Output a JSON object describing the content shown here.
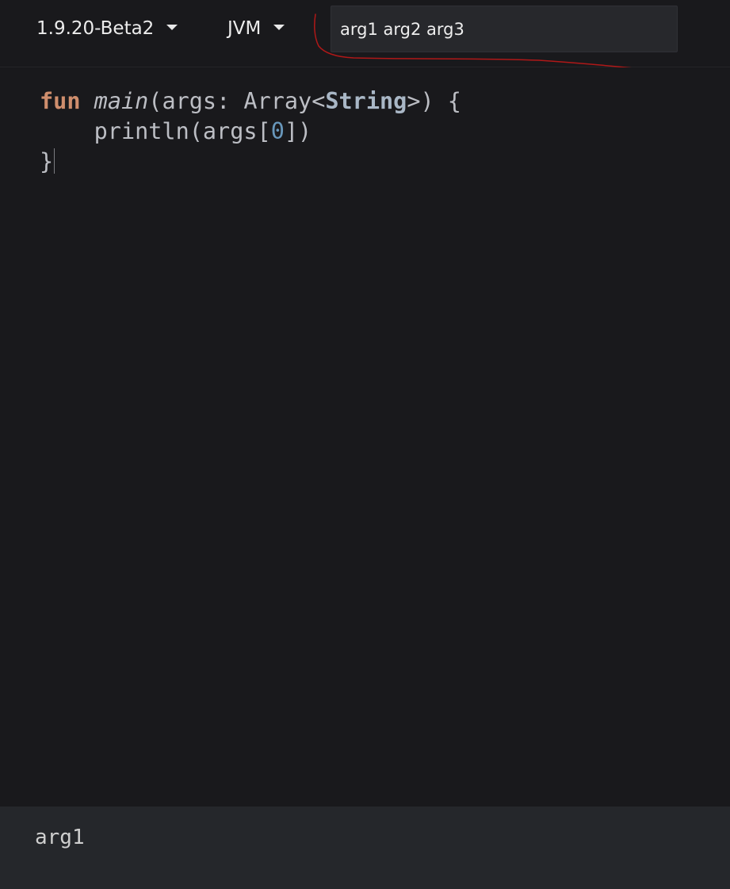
{
  "toolbar": {
    "version": {
      "label": "1.9.20-Beta2"
    },
    "platform": {
      "label": "JVM"
    },
    "program_args": {
      "value": "arg1 arg2 arg3"
    }
  },
  "editor": {
    "lines": [
      {
        "tokens": [
          "fun",
          " ",
          "main",
          "(args: Array<",
          "String",
          ">) {"
        ]
      },
      {
        "tokens": [
          "    println(args[",
          "0",
          "])"
        ]
      },
      {
        "tokens": [
          "}"
        ]
      }
    ]
  },
  "output": {
    "text": "arg1"
  },
  "colors": {
    "background": "#19191c",
    "keyword": "#cf8e6d",
    "type": "#a9b7c6",
    "number": "#6897bb",
    "annotation": "#b01818"
  }
}
